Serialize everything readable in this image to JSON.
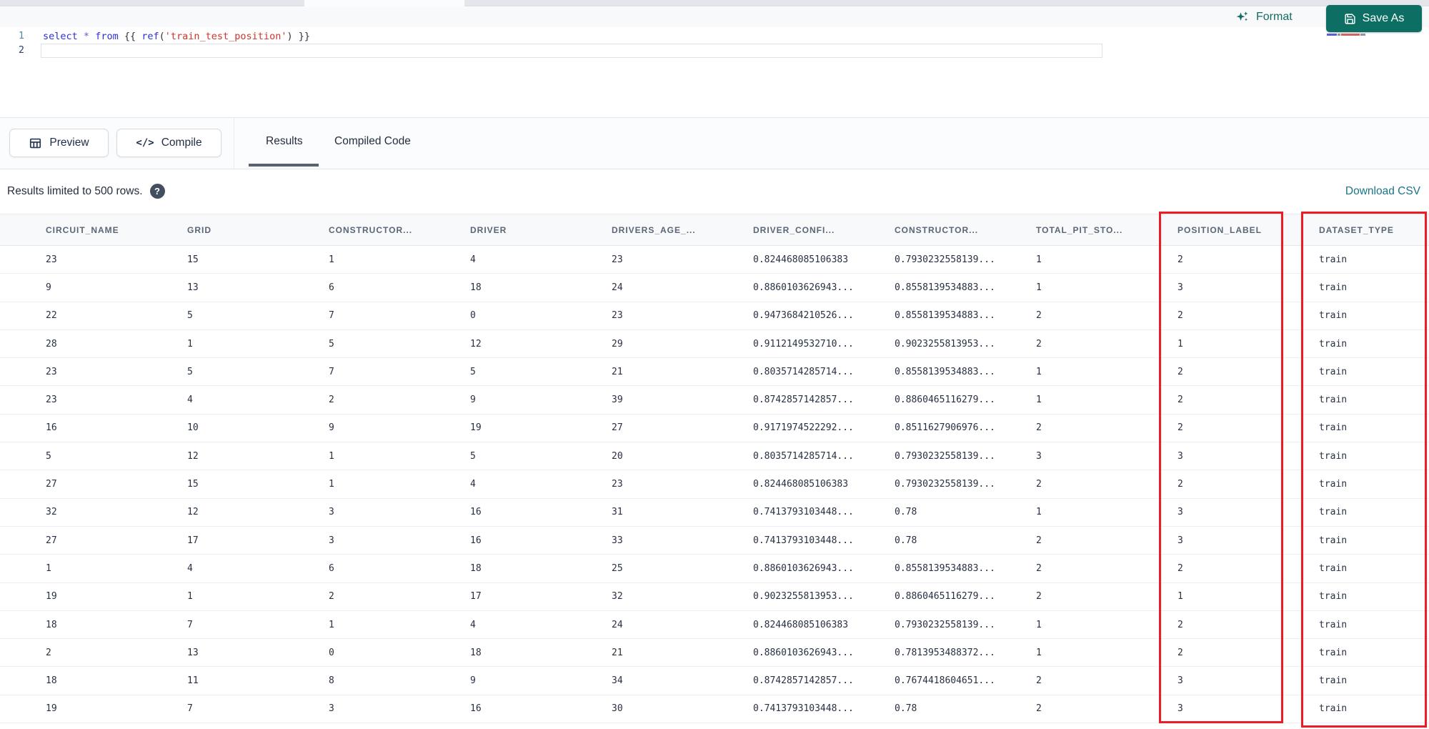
{
  "colors": {
    "brand_teal": "#0d6f63",
    "link_teal": "#1b7488",
    "annotation_red": "#ed1c24"
  },
  "header": {
    "format_label": "Format",
    "save_as_label": "Save As"
  },
  "editor": {
    "line_numbers": [
      "1",
      "2"
    ],
    "line1_tokens": [
      {
        "text": "select",
        "type": "keyword"
      },
      {
        "text": " ",
        "type": "plain"
      },
      {
        "text": "*",
        "type": "operator"
      },
      {
        "text": " ",
        "type": "plain"
      },
      {
        "text": "from",
        "type": "keyword"
      },
      {
        "text": " {{ ",
        "type": "plain"
      },
      {
        "text": "ref",
        "type": "function"
      },
      {
        "text": "(",
        "type": "plain"
      },
      {
        "text": "'train_test_position'",
        "type": "string"
      },
      {
        "text": ") }}",
        "type": "plain"
      }
    ]
  },
  "toolbar": {
    "preview_label": "Preview",
    "compile_label": "Compile",
    "compile_glyph": "</>",
    "tabs": [
      {
        "label": "Results",
        "active": true
      },
      {
        "label": "Compiled Code",
        "active": false
      }
    ]
  },
  "results_bar": {
    "info": "Results limited to 500 rows.",
    "help_glyph": "?",
    "download_label": "Download CSV"
  },
  "table": {
    "columns": [
      "CIRCUIT_NAME",
      "GRID",
      "CONSTRUCTOR...",
      "DRIVER",
      "DRIVERS_AGE_...",
      "DRIVER_CONFI...",
      "CONSTRUCTOR...",
      "TOTAL_PIT_STO...",
      "POSITION_LABEL",
      "DATASET_TYPE"
    ],
    "rows": [
      [
        "23",
        "15",
        "1",
        "4",
        "23",
        "0.824468085106383",
        "0.7930232558139...",
        "1",
        "2",
        "train"
      ],
      [
        "9",
        "13",
        "6",
        "18",
        "24",
        "0.8860103626943...",
        "0.8558139534883...",
        "1",
        "3",
        "train"
      ],
      [
        "22",
        "5",
        "7",
        "0",
        "23",
        "0.9473684210526...",
        "0.8558139534883...",
        "2",
        "2",
        "train"
      ],
      [
        "28",
        "1",
        "5",
        "12",
        "29",
        "0.9112149532710...",
        "0.9023255813953...",
        "2",
        "1",
        "train"
      ],
      [
        "23",
        "5",
        "7",
        "5",
        "21",
        "0.8035714285714...",
        "0.8558139534883...",
        "1",
        "2",
        "train"
      ],
      [
        "23",
        "4",
        "2",
        "9",
        "39",
        "0.8742857142857...",
        "0.8860465116279...",
        "1",
        "2",
        "train"
      ],
      [
        "16",
        "10",
        "9",
        "19",
        "27",
        "0.9171974522292...",
        "0.8511627906976...",
        "2",
        "2",
        "train"
      ],
      [
        "5",
        "12",
        "1",
        "5",
        "20",
        "0.8035714285714...",
        "0.7930232558139...",
        "3",
        "3",
        "train"
      ],
      [
        "27",
        "15",
        "1",
        "4",
        "23",
        "0.824468085106383",
        "0.7930232558139...",
        "2",
        "2",
        "train"
      ],
      [
        "32",
        "12",
        "3",
        "16",
        "31",
        "0.7413793103448...",
        "0.78",
        "1",
        "3",
        "train"
      ],
      [
        "27",
        "17",
        "3",
        "16",
        "33",
        "0.7413793103448...",
        "0.78",
        "2",
        "3",
        "train"
      ],
      [
        "1",
        "4",
        "6",
        "18",
        "25",
        "0.8860103626943...",
        "0.8558139534883...",
        "2",
        "2",
        "train"
      ],
      [
        "19",
        "1",
        "2",
        "17",
        "32",
        "0.9023255813953...",
        "0.8860465116279...",
        "2",
        "1",
        "train"
      ],
      [
        "18",
        "7",
        "1",
        "4",
        "24",
        "0.824468085106383",
        "0.7930232558139...",
        "1",
        "2",
        "train"
      ],
      [
        "2",
        "13",
        "0",
        "18",
        "21",
        "0.8860103626943...",
        "0.7813953488372...",
        "1",
        "2",
        "train"
      ],
      [
        "18",
        "11",
        "8",
        "9",
        "34",
        "0.8742857142857...",
        "0.7674418604651...",
        "2",
        "3",
        "train"
      ],
      [
        "19",
        "7",
        "3",
        "16",
        "30",
        "0.7413793103448...",
        "0.78",
        "2",
        "3",
        "train"
      ]
    ],
    "annotated_columns": [
      "POSITION_LABEL",
      "DATASET_TYPE"
    ]
  }
}
